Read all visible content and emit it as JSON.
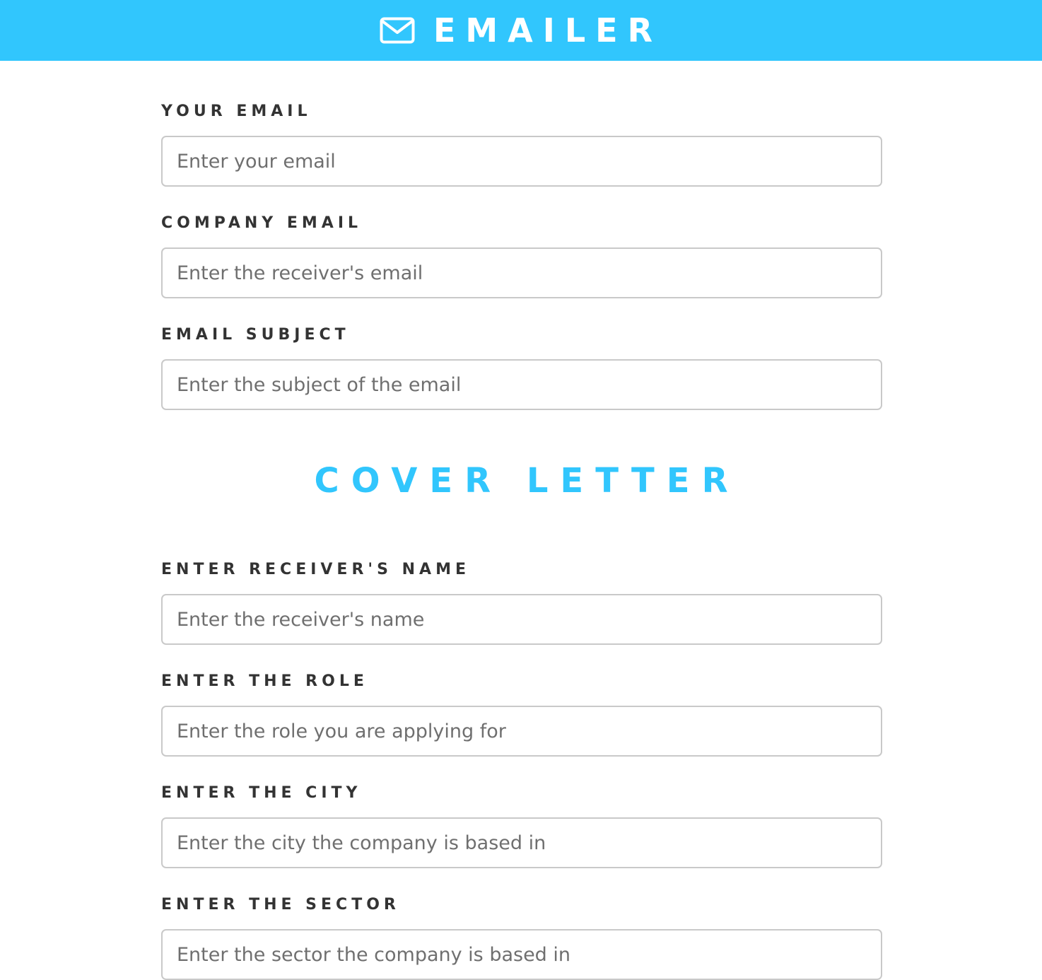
{
  "header": {
    "title": "EMAILER",
    "icon": "envelope-icon",
    "background_color": "#31c6fd"
  },
  "fields_top": [
    {
      "label": "YOUR EMAIL",
      "placeholder": "Enter your email",
      "value": ""
    },
    {
      "label": "COMPANY EMAIL",
      "placeholder": "Enter the receiver's email",
      "value": ""
    },
    {
      "label": "EMAIL SUBJECT",
      "placeholder": "Enter the subject of the email",
      "value": ""
    }
  ],
  "cover_letter": {
    "title": "COVER LETTER",
    "title_color": "#31c6fd",
    "fields": [
      {
        "label": "ENTER RECEIVER'S NAME",
        "placeholder": "Enter the receiver's name",
        "value": ""
      },
      {
        "label": "ENTER THE ROLE",
        "placeholder": "Enter the role you are applying for",
        "value": ""
      },
      {
        "label": "ENTER THE CITY",
        "placeholder": "Enter the city the company is based in",
        "value": ""
      },
      {
        "label": "ENTER THE SECTOR",
        "placeholder": "Enter the sector the company is based in",
        "value": ""
      }
    ]
  }
}
